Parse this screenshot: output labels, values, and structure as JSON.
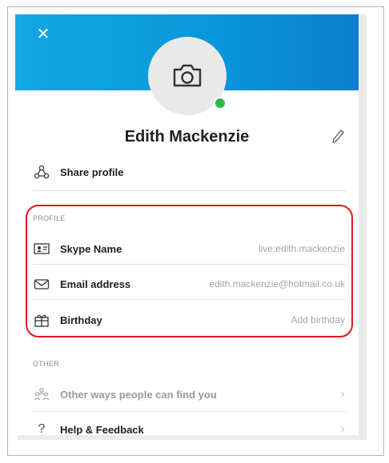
{
  "header": {
    "close_glyph": "✕"
  },
  "profile": {
    "name": "Edith Mackenzie",
    "share_label": "Share profile"
  },
  "profile_section": {
    "heading": "PROFILE",
    "items": [
      {
        "label": "Skype Name",
        "value": "live:edith.mackenzie",
        "icon": "id-card-icon"
      },
      {
        "label": "Email address",
        "value": "edith.mackenzie@hotmail.co.uk",
        "icon": "envelope-icon"
      },
      {
        "label": "Birthday",
        "value": "Add birthday",
        "icon": "gift-icon"
      }
    ]
  },
  "other_section": {
    "heading": "OTHER",
    "items": [
      {
        "label": "Other ways people can find you",
        "icon": "people-icon"
      },
      {
        "label": "Help & Feedback",
        "icon": "question-icon"
      }
    ]
  },
  "colors": {
    "header": "#0a98db",
    "online": "#2db84b",
    "highlight": "#e0191c"
  }
}
